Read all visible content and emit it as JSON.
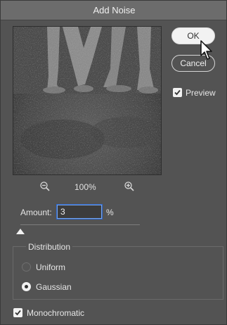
{
  "dialog": {
    "title": "Add Noise"
  },
  "preview": {
    "zoom_level": "100%",
    "zoom_out_icon": "zoom-out-icon",
    "zoom_in_icon": "zoom-in-icon"
  },
  "buttons": {
    "ok_label": "OK",
    "cancel_label": "Cancel"
  },
  "options": {
    "preview_label": "Preview",
    "preview_checked": true,
    "monochromatic_label": "Monochromatic",
    "monochromatic_checked": true
  },
  "amount": {
    "label": "Amount:",
    "value": "3",
    "unit": "%"
  },
  "distribution": {
    "legend": "Distribution",
    "options": [
      {
        "label": "Uniform",
        "selected": false
      },
      {
        "label": "Gaussian",
        "selected": true
      }
    ]
  },
  "colors": {
    "dialog_bg": "#535353",
    "input_focus": "#2e66c8",
    "button_light": "#f2f2f2"
  }
}
